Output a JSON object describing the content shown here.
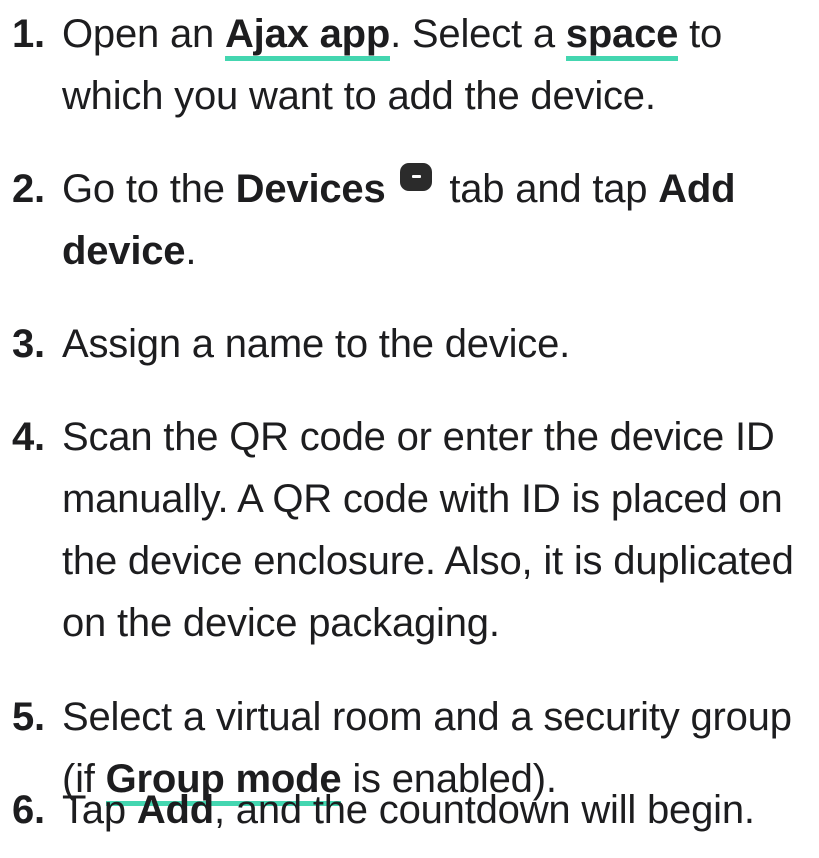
{
  "steps": [
    {
      "number": "1.",
      "pre": "Open an ",
      "link1": "Ajax app",
      "mid": ". Select a ",
      "link2": "space",
      "post": " to which you want to add the device."
    },
    {
      "number": "2.",
      "pre": "Go to the ",
      "bold1": "Devices",
      "mid": " tab and tap ",
      "bold2": "Add device",
      "post": "."
    },
    {
      "number": "3.",
      "text": "Assign a name to the device."
    },
    {
      "number": "4.",
      "text": "Scan the QR code or enter the device ID manually. A QR code with ID is placed on the device enclosure. Also, it is duplicated on the device packaging."
    },
    {
      "number": "5.",
      "pre": "Select a virtual room and a security group (if ",
      "link": "Group mode",
      "post": " is enabled)."
    },
    {
      "number": "6.",
      "pre": "Tap ",
      "bold": "Add",
      "post": ", and the countdown will begin."
    }
  ],
  "icons": {
    "devices_tab": "devices-tab-icon"
  },
  "colors": {
    "link_underline": "#44d6b0",
    "text": "#1d1d1f",
    "icon_bg": "#2b2b2b"
  }
}
